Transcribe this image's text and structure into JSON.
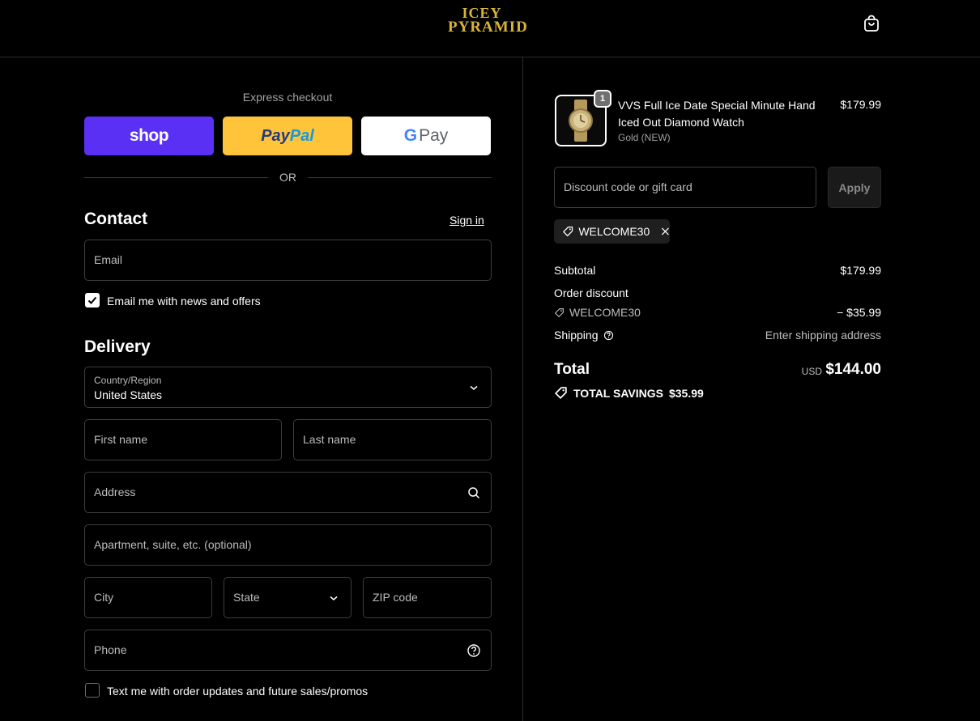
{
  "brand": {
    "logo_line1": "ICEY",
    "logo_line2": "PYRAMID"
  },
  "express": {
    "title": "Express checkout",
    "shop_label": "shop",
    "paypal_part1": "Pay",
    "paypal_part2": "Pal",
    "gpay_g": "G",
    "gpay_label": "Pay",
    "or_label": "OR"
  },
  "contact": {
    "heading": "Contact",
    "sign_in": "Sign in",
    "email_placeholder": "Email",
    "news_label": "Email me with news and offers",
    "news_checked": true
  },
  "delivery": {
    "heading": "Delivery",
    "country_label": "Country/Region",
    "country_value": "United States",
    "first_name": "First name",
    "last_name": "Last name",
    "address": "Address",
    "apartment": "Apartment, suite, etc. (optional)",
    "city": "City",
    "state": "State",
    "zip": "ZIP code",
    "phone": "Phone",
    "sms_label": "Text me with order updates and future sales/promos",
    "sms_checked": false
  },
  "cart": {
    "item": {
      "quantity": "1",
      "title": "VVS Full Ice Date Special Minute Hand Iced Out Diamond Watch",
      "variant": "Gold (NEW)",
      "price": "$179.99"
    },
    "discount_placeholder": "Discount code or gift card",
    "apply_label": "Apply",
    "applied_code": "WELCOME30"
  },
  "summary": {
    "subtotal_label": "Subtotal",
    "subtotal_value": "$179.99",
    "order_discount_label": "Order discount",
    "discount_code": "WELCOME30",
    "discount_value": "− $35.99",
    "shipping_label": "Shipping",
    "shipping_value": "Enter shipping address",
    "total_label": "Total",
    "currency": "USD",
    "total_value": "$144.00",
    "savings_label": "TOTAL SAVINGS",
    "savings_value": "$35.99"
  },
  "colors": {
    "background": "#000000",
    "shop_purple": "#5a31f4",
    "paypal_yellow": "#ffc439",
    "logo_gold": "#d8b43a"
  }
}
